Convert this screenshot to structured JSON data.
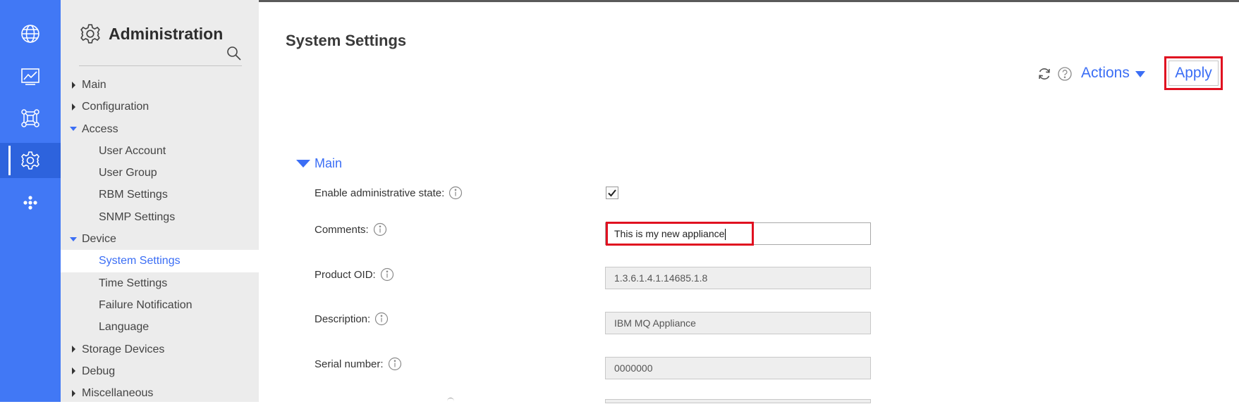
{
  "rail": {
    "items": [
      {
        "icon": "globe-icon"
      },
      {
        "icon": "monitor-chart-icon"
      },
      {
        "icon": "network-icon"
      },
      {
        "icon": "gear-icon",
        "active": true
      },
      {
        "icon": "dots-icon"
      }
    ]
  },
  "sidebar": {
    "title": "Administration",
    "tree": [
      {
        "label": "Main",
        "level": 0,
        "state": "collapsed"
      },
      {
        "label": "Configuration",
        "level": 0,
        "state": "collapsed"
      },
      {
        "label": "Access",
        "level": 0,
        "state": "expanded"
      },
      {
        "label": "User Account",
        "level": 1
      },
      {
        "label": "User Group",
        "level": 1
      },
      {
        "label": "RBM Settings",
        "level": 1
      },
      {
        "label": "SNMP Settings",
        "level": 1
      },
      {
        "label": "Device",
        "level": 0,
        "state": "expanded"
      },
      {
        "label": "System Settings",
        "level": 1,
        "selected": true
      },
      {
        "label": "Time Settings",
        "level": 1
      },
      {
        "label": "Failure Notification",
        "level": 1
      },
      {
        "label": "Language",
        "level": 1
      },
      {
        "label": "Storage Devices",
        "level": 0,
        "state": "collapsed"
      },
      {
        "label": "Debug",
        "level": 0,
        "state": "collapsed"
      },
      {
        "label": "Miscellaneous",
        "level": 0,
        "state": "collapsed"
      }
    ]
  },
  "main": {
    "title": "System Settings",
    "actions_label": "Actions",
    "apply_label": "Apply",
    "section_label": "Main",
    "fields": {
      "admin_state": {
        "label": "Enable administrative state:",
        "checked": true
      },
      "comments": {
        "label": "Comments:",
        "value": "This is my new appliance"
      },
      "product_oid": {
        "label": "Product OID:",
        "value": "1.3.6.1.4.1.14685.1.8"
      },
      "description": {
        "label": "Description:",
        "value": "IBM MQ Appliance"
      },
      "serial_number": {
        "label": "Serial number:",
        "value": "0000000"
      }
    }
  },
  "colors": {
    "rail": "#4178f5",
    "accent": "#3b6ef5",
    "highlight": "#e01020",
    "sidebar_bg": "#ececec"
  }
}
